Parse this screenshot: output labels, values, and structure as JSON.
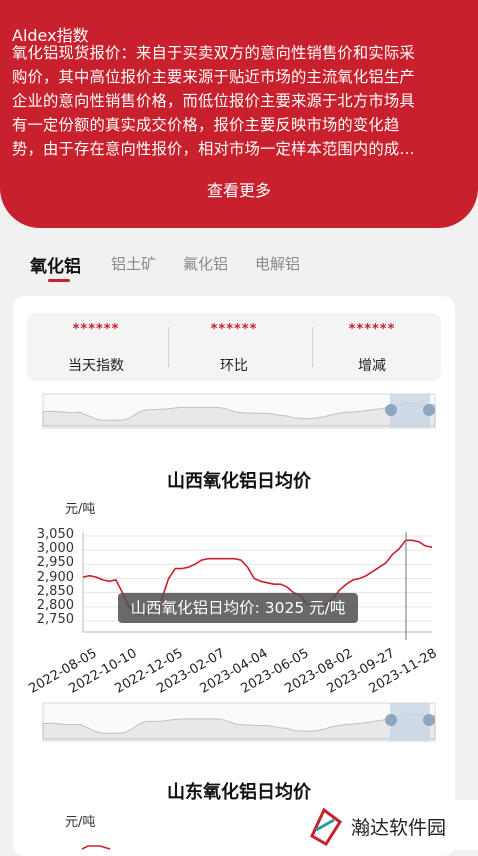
{
  "header": {
    "title": "Aldex指数",
    "description": "氧化铝现货报价：来自于买卖双方的意向性销售价和实际采\n购价，其中高位报价主要来源于贴近市场的主流氧化铝生产\n企业的意向性销售价格，而低位报价主要来源于北方市场具\n有一定份额的真实成交价格，报价主要反映市场的变化趋\n势，由于存在意向性报价，相对市场一定样本范围内的成…",
    "see_more": "查看更多"
  },
  "tabs": [
    "氧化铝",
    "铝土矿",
    "氟化铝",
    "电解铝"
  ],
  "stats": [
    {
      "value": "******",
      "label": "当天指数"
    },
    {
      "value": "******",
      "label": "环比"
    },
    {
      "value": "******",
      "label": "增减"
    }
  ],
  "colors": {
    "brand": "#c8202c",
    "line": "#c8202c"
  },
  "watermark": {
    "text": "瀚达软件园"
  },
  "chart_data": [
    {
      "type": "line",
      "title": "山西氧化铝日均价",
      "unit": "元/吨",
      "yticks": [
        "3,050",
        "3,000",
        "2,950",
        "2,900",
        "2,850",
        "2,800",
        "2,750"
      ],
      "ylim": [
        2750,
        3050
      ],
      "x": [
        "2022-08-05",
        "2022-10-10",
        "2022-12-05",
        "2023-02-07",
        "2023-04-04",
        "2023-06-05",
        "2023-08-02",
        "2023-09-27",
        "2023-11-28"
      ],
      "series": [
        {
          "values": [
            2905,
            2910,
            2905,
            2895,
            2890,
            2895,
            2850,
            2800,
            2775,
            2775,
            2775,
            2780,
            2830,
            2900,
            2935,
            2935,
            2940,
            2950,
            2965,
            2970,
            2970,
            2970,
            2970,
            2970,
            2965,
            2940,
            2900,
            2890,
            2885,
            2880,
            2880,
            2870,
            2850,
            2840,
            2810,
            2805,
            2800,
            2810,
            2830,
            2860,
            2880,
            2895,
            2900,
            2910,
            2925,
            2940,
            2955,
            2985,
            3005,
            3035,
            3035,
            3030,
            3015,
            3010
          ]
        }
      ],
      "tooltip": "山西氧化铝日均价: 3025 元/吨"
    },
    {
      "type": "line",
      "title": "山东氧化铝日均价",
      "unit": "元/吨"
    }
  ]
}
